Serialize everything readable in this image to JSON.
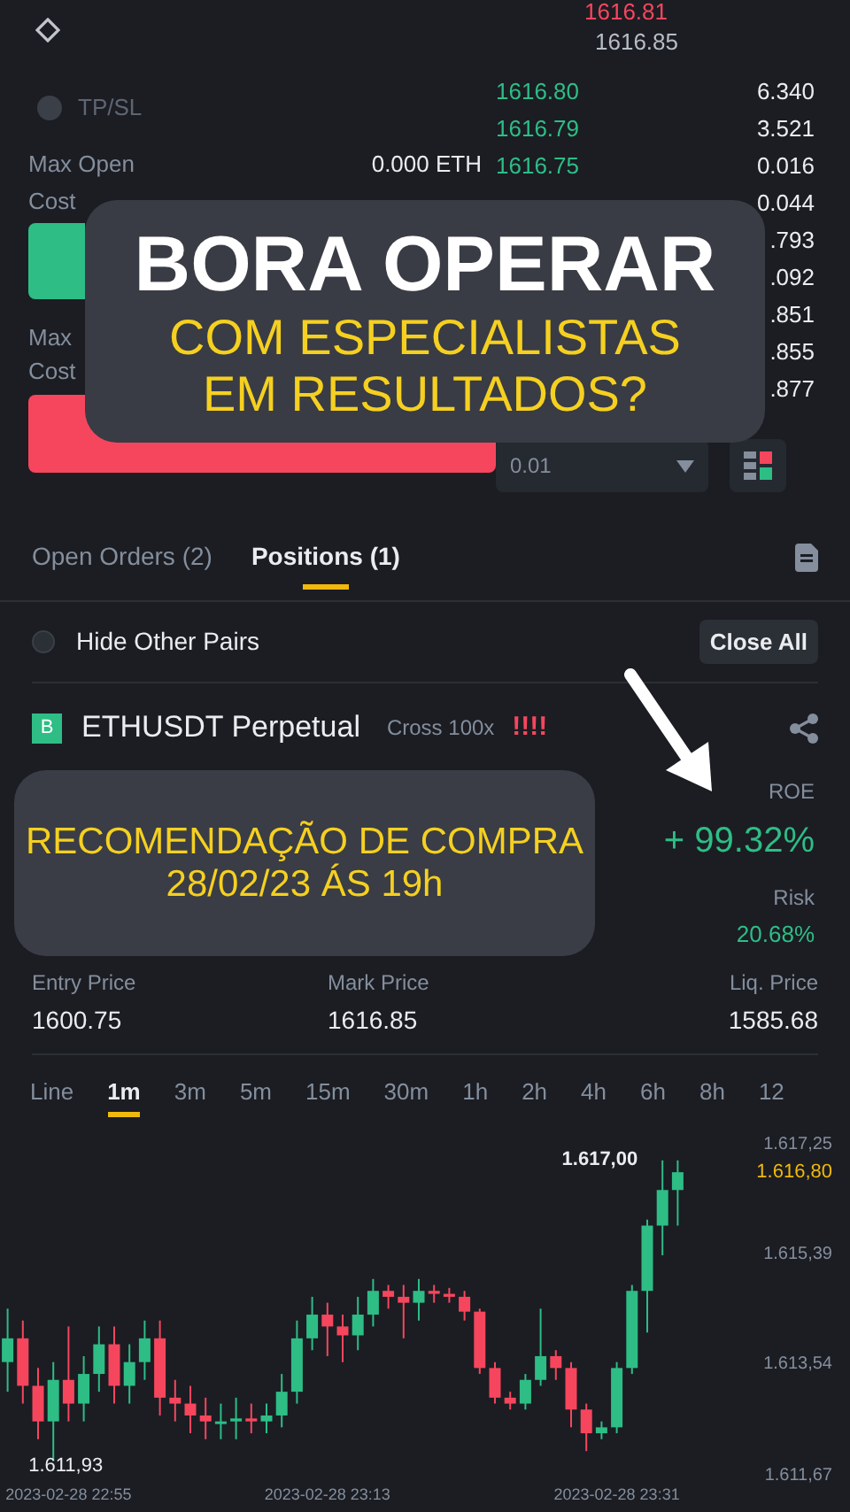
{
  "order_form": {
    "tpsl_label": "TP/SL",
    "rows_top": [
      {
        "label": "Max Open",
        "value": "0.000 ETH"
      },
      {
        "label": "Cost"
      }
    ],
    "rows_bottom": [
      {
        "label": "Max"
      },
      {
        "label": "Cost"
      }
    ]
  },
  "order_book": {
    "last_price": "1616.81",
    "mark_price": "1616.85",
    "bids": [
      {
        "price": "1616.80",
        "amount": "6.340"
      },
      {
        "price": "1616.79",
        "amount": "3.521"
      },
      {
        "price": "1616.75",
        "amount": "0.016"
      },
      {
        "amount": "0.044"
      },
      {
        "amount": ".793"
      },
      {
        "amount": ".092"
      },
      {
        "amount": ".851"
      },
      {
        "amount": ".855"
      },
      {
        "amount": ".877"
      }
    ],
    "size_select": "0.01"
  },
  "banner": {
    "title": "BORA OPERAR",
    "subtitle_1": "COM ESPECIALISTAS",
    "subtitle_2": "EM RESULTADOS?"
  },
  "tabs": [
    {
      "label": "Open Orders (2)",
      "selected": false
    },
    {
      "label": "Positions (1)",
      "selected": true
    }
  ],
  "filter": {
    "label": "Hide Other Pairs",
    "checked": false,
    "button": "Close All"
  },
  "position": {
    "badge": "B",
    "symbol": "ETHUSDT Perpetual",
    "margin": "Cross 100x",
    "risk_marks": "!!!!",
    "roe_label": "ROE",
    "roe": "+ 99.32%",
    "risk_label": "Risk",
    "risk": "20.68%",
    "stats": [
      {
        "label": "Entry Price",
        "value": "1600.75"
      },
      {
        "label": "Mark Price",
        "value": "1616.85"
      },
      {
        "label": "Liq. Price",
        "value": "1585.68"
      }
    ]
  },
  "recommendation": {
    "line_1": "RECOMENDAÇÃO DE COMPRA",
    "line_2": "28/02/23 ÁS 19h"
  },
  "intervals": [
    {
      "label": "Line",
      "selected": false
    },
    {
      "label": "1m",
      "selected": true
    },
    {
      "label": "3m",
      "selected": false
    },
    {
      "label": "5m",
      "selected": false
    },
    {
      "label": "15m",
      "selected": false
    },
    {
      "label": "30m",
      "selected": false
    },
    {
      "label": "1h",
      "selected": false
    },
    {
      "label": "2h",
      "selected": false
    },
    {
      "label": "4h",
      "selected": false
    },
    {
      "label": "6h",
      "selected": false
    },
    {
      "label": "8h",
      "selected": false
    },
    {
      "label": "12",
      "selected": false
    }
  ],
  "chart": {
    "chart_data": {
      "type": "candlestick",
      "categories": [
        null,
        null,
        null,
        null,
        "2023-02-28 22:55",
        null,
        null,
        null,
        null,
        null,
        null,
        null,
        null,
        null,
        null,
        null,
        null,
        null,
        null,
        null,
        null,
        "2023-02-28 23:13",
        null,
        null,
        null,
        null,
        null,
        null,
        null,
        null,
        null,
        null,
        null,
        null,
        null,
        null,
        null,
        null,
        null,
        null,
        "2023-02-28 23:31",
        null,
        null,
        null,
        null
      ],
      "ohlc": [
        [
          1613.6,
          1614.5,
          1613.1,
          1614.0
        ],
        [
          1614.0,
          1614.3,
          1612.9,
          1613.2
        ],
        [
          1613.2,
          1613.5,
          1612.3,
          1612.6
        ],
        [
          1612.6,
          1613.6,
          1611.93,
          1613.3
        ],
        [
          1613.3,
          1614.2,
          1612.6,
          1612.9
        ],
        [
          1612.9,
          1613.7,
          1612.6,
          1613.4
        ],
        [
          1613.4,
          1614.2,
          1613.1,
          1613.9
        ],
        [
          1613.9,
          1614.2,
          1612.9,
          1613.2
        ],
        [
          1613.2,
          1613.9,
          1612.9,
          1613.6
        ],
        [
          1613.6,
          1614.3,
          1613.3,
          1614.0
        ],
        [
          1614.0,
          1614.3,
          1612.7,
          1613.0
        ],
        [
          1613.0,
          1613.3,
          1612.6,
          1612.9
        ],
        [
          1612.9,
          1613.2,
          1612.4,
          1612.7
        ],
        [
          1612.7,
          1613.0,
          1612.3,
          1612.6
        ],
        [
          1612.6,
          1612.9,
          1612.3,
          1612.6
        ],
        [
          1612.6,
          1613.0,
          1612.3,
          1612.65
        ],
        [
          1612.65,
          1612.9,
          1612.4,
          1612.6
        ],
        [
          1612.6,
          1612.9,
          1612.4,
          1612.7
        ],
        [
          1612.7,
          1613.4,
          1612.5,
          1613.1
        ],
        [
          1613.1,
          1614.3,
          1612.9,
          1614.0
        ],
        [
          1614.0,
          1614.7,
          1613.8,
          1614.4
        ],
        [
          1614.4,
          1614.6,
          1613.7,
          1614.2
        ],
        [
          1614.2,
          1614.4,
          1613.6,
          1614.05
        ],
        [
          1614.05,
          1614.7,
          1613.8,
          1614.4
        ],
        [
          1614.4,
          1615.0,
          1614.2,
          1614.8
        ],
        [
          1614.8,
          1614.9,
          1614.5,
          1614.7
        ],
        [
          1614.7,
          1614.9,
          1614.0,
          1614.6
        ],
        [
          1614.6,
          1615.0,
          1614.3,
          1614.8
        ],
        [
          1614.8,
          1614.9,
          1614.6,
          1614.75
        ],
        [
          1614.75,
          1614.85,
          1614.6,
          1614.7
        ],
        [
          1614.7,
          1614.8,
          1614.3,
          1614.45
        ],
        [
          1614.45,
          1614.5,
          1613.4,
          1613.5
        ],
        [
          1613.5,
          1613.6,
          1612.9,
          1613.0
        ],
        [
          1613.0,
          1613.1,
          1612.8,
          1612.9
        ],
        [
          1612.9,
          1613.4,
          1612.8,
          1613.3
        ],
        [
          1613.3,
          1614.5,
          1613.2,
          1613.7
        ],
        [
          1613.7,
          1613.8,
          1613.3,
          1613.5
        ],
        [
          1613.5,
          1613.6,
          1612.5,
          1612.8
        ],
        [
          1612.8,
          1612.9,
          1612.1,
          1612.4
        ],
        [
          1612.4,
          1612.6,
          1612.3,
          1612.5
        ],
        [
          1612.5,
          1613.6,
          1612.4,
          1613.5
        ],
        [
          1613.5,
          1614.9,
          1613.4,
          1614.8
        ],
        [
          1614.8,
          1616.0,
          1614.1,
          1615.9
        ],
        [
          1615.9,
          1617.0,
          1615.4,
          1616.5
        ],
        [
          1616.5,
          1617.0,
          1615.9,
          1616.8
        ]
      ],
      "yticks": [
        {
          "value": 1617.25,
          "label": "1.617,25"
        },
        {
          "value": 1615.39,
          "label": "1.615,39"
        },
        {
          "value": 1613.54,
          "label": "1.613,54"
        },
        {
          "value": 1611.67,
          "label": "1.611,67"
        }
      ],
      "ylim": [
        1611.67,
        1617.25
      ],
      "annotations": [
        "1.617,00",
        "1.611,93",
        "1.616,80"
      ]
    }
  }
}
